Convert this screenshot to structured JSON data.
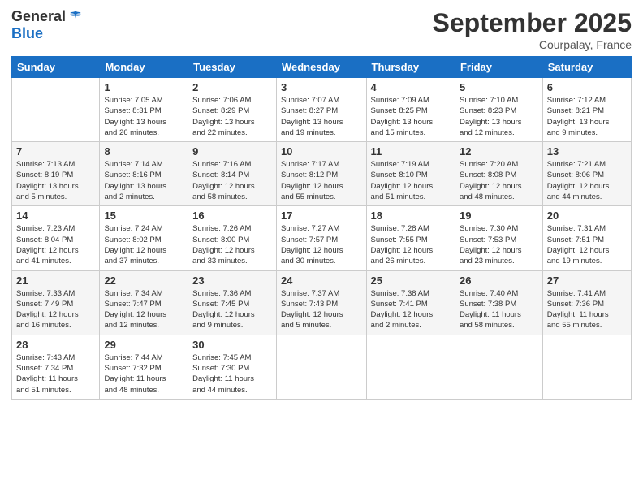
{
  "logo": {
    "general": "General",
    "blue": "Blue"
  },
  "title": "September 2025",
  "location": "Courpalay, France",
  "days_header": [
    "Sunday",
    "Monday",
    "Tuesday",
    "Wednesday",
    "Thursday",
    "Friday",
    "Saturday"
  ],
  "weeks": [
    [
      {
        "day": "",
        "info": ""
      },
      {
        "day": "1",
        "info": "Sunrise: 7:05 AM\nSunset: 8:31 PM\nDaylight: 13 hours\nand 26 minutes."
      },
      {
        "day": "2",
        "info": "Sunrise: 7:06 AM\nSunset: 8:29 PM\nDaylight: 13 hours\nand 22 minutes."
      },
      {
        "day": "3",
        "info": "Sunrise: 7:07 AM\nSunset: 8:27 PM\nDaylight: 13 hours\nand 19 minutes."
      },
      {
        "day": "4",
        "info": "Sunrise: 7:09 AM\nSunset: 8:25 PM\nDaylight: 13 hours\nand 15 minutes."
      },
      {
        "day": "5",
        "info": "Sunrise: 7:10 AM\nSunset: 8:23 PM\nDaylight: 13 hours\nand 12 minutes."
      },
      {
        "day": "6",
        "info": "Sunrise: 7:12 AM\nSunset: 8:21 PM\nDaylight: 13 hours\nand 9 minutes."
      }
    ],
    [
      {
        "day": "7",
        "info": "Sunrise: 7:13 AM\nSunset: 8:19 PM\nDaylight: 13 hours\nand 5 minutes."
      },
      {
        "day": "8",
        "info": "Sunrise: 7:14 AM\nSunset: 8:16 PM\nDaylight: 13 hours\nand 2 minutes."
      },
      {
        "day": "9",
        "info": "Sunrise: 7:16 AM\nSunset: 8:14 PM\nDaylight: 12 hours\nand 58 minutes."
      },
      {
        "day": "10",
        "info": "Sunrise: 7:17 AM\nSunset: 8:12 PM\nDaylight: 12 hours\nand 55 minutes."
      },
      {
        "day": "11",
        "info": "Sunrise: 7:19 AM\nSunset: 8:10 PM\nDaylight: 12 hours\nand 51 minutes."
      },
      {
        "day": "12",
        "info": "Sunrise: 7:20 AM\nSunset: 8:08 PM\nDaylight: 12 hours\nand 48 minutes."
      },
      {
        "day": "13",
        "info": "Sunrise: 7:21 AM\nSunset: 8:06 PM\nDaylight: 12 hours\nand 44 minutes."
      }
    ],
    [
      {
        "day": "14",
        "info": "Sunrise: 7:23 AM\nSunset: 8:04 PM\nDaylight: 12 hours\nand 41 minutes."
      },
      {
        "day": "15",
        "info": "Sunrise: 7:24 AM\nSunset: 8:02 PM\nDaylight: 12 hours\nand 37 minutes."
      },
      {
        "day": "16",
        "info": "Sunrise: 7:26 AM\nSunset: 8:00 PM\nDaylight: 12 hours\nand 33 minutes."
      },
      {
        "day": "17",
        "info": "Sunrise: 7:27 AM\nSunset: 7:57 PM\nDaylight: 12 hours\nand 30 minutes."
      },
      {
        "day": "18",
        "info": "Sunrise: 7:28 AM\nSunset: 7:55 PM\nDaylight: 12 hours\nand 26 minutes."
      },
      {
        "day": "19",
        "info": "Sunrise: 7:30 AM\nSunset: 7:53 PM\nDaylight: 12 hours\nand 23 minutes."
      },
      {
        "day": "20",
        "info": "Sunrise: 7:31 AM\nSunset: 7:51 PM\nDaylight: 12 hours\nand 19 minutes."
      }
    ],
    [
      {
        "day": "21",
        "info": "Sunrise: 7:33 AM\nSunset: 7:49 PM\nDaylight: 12 hours\nand 16 minutes."
      },
      {
        "day": "22",
        "info": "Sunrise: 7:34 AM\nSunset: 7:47 PM\nDaylight: 12 hours\nand 12 minutes."
      },
      {
        "day": "23",
        "info": "Sunrise: 7:36 AM\nSunset: 7:45 PM\nDaylight: 12 hours\nand 9 minutes."
      },
      {
        "day": "24",
        "info": "Sunrise: 7:37 AM\nSunset: 7:43 PM\nDaylight: 12 hours\nand 5 minutes."
      },
      {
        "day": "25",
        "info": "Sunrise: 7:38 AM\nSunset: 7:41 PM\nDaylight: 12 hours\nand 2 minutes."
      },
      {
        "day": "26",
        "info": "Sunrise: 7:40 AM\nSunset: 7:38 PM\nDaylight: 11 hours\nand 58 minutes."
      },
      {
        "day": "27",
        "info": "Sunrise: 7:41 AM\nSunset: 7:36 PM\nDaylight: 11 hours\nand 55 minutes."
      }
    ],
    [
      {
        "day": "28",
        "info": "Sunrise: 7:43 AM\nSunset: 7:34 PM\nDaylight: 11 hours\nand 51 minutes."
      },
      {
        "day": "29",
        "info": "Sunrise: 7:44 AM\nSunset: 7:32 PM\nDaylight: 11 hours\nand 48 minutes."
      },
      {
        "day": "30",
        "info": "Sunrise: 7:45 AM\nSunset: 7:30 PM\nDaylight: 11 hours\nand 44 minutes."
      },
      {
        "day": "",
        "info": ""
      },
      {
        "day": "",
        "info": ""
      },
      {
        "day": "",
        "info": ""
      },
      {
        "day": "",
        "info": ""
      }
    ]
  ]
}
